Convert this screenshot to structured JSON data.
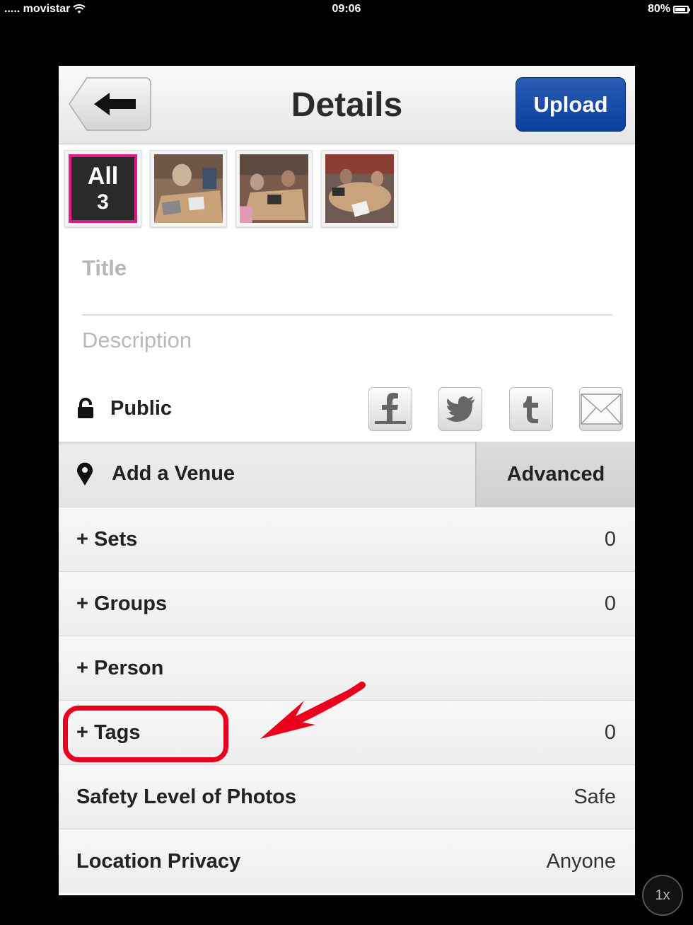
{
  "status_bar": {
    "carrier": "..... movistar",
    "time": "09:06",
    "battery": "80%"
  },
  "nav": {
    "title": "Details",
    "upload_label": "Upload",
    "back_icon": "arrow-left-icon"
  },
  "thumbnails": {
    "all_label": "All",
    "all_count": "3"
  },
  "form": {
    "title_placeholder": "Title",
    "description_placeholder": "Description"
  },
  "privacy": {
    "label": "Public",
    "icon": "lock-icon"
  },
  "share_icons": [
    "facebook-icon",
    "twitter-icon",
    "tumblr-icon",
    "mail-icon"
  ],
  "venue": {
    "label": "Add a Venue",
    "advanced_label": "Advanced",
    "icon": "location-pin-icon"
  },
  "rows": [
    {
      "label": "+ Sets",
      "value": "0"
    },
    {
      "label": "+ Groups",
      "value": "0"
    },
    {
      "label": "+ Person",
      "value": ""
    },
    {
      "label": "+ Tags",
      "value": "0"
    },
    {
      "label": "Safety Level of Photos",
      "value": "Safe"
    },
    {
      "label": "Location Privacy",
      "value": "Anyone"
    }
  ],
  "zoom_label": "1x",
  "colors": {
    "accent_upload": "#0a3f9c",
    "selected_border": "#e0198b",
    "annotation_red": "#e8001d"
  }
}
